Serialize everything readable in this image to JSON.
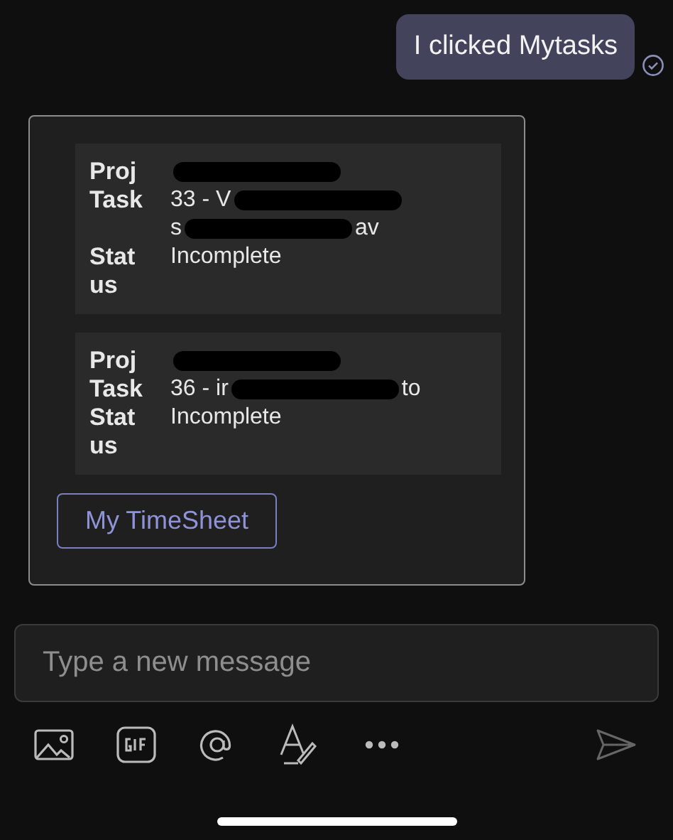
{
  "sent_message": {
    "text": "I clicked Mytasks",
    "delivered": true
  },
  "card": {
    "tasks": [
      {
        "fields": [
          {
            "label": "Proj",
            "lines": [
              [
                {
                  "kind": "redaction"
                }
              ]
            ]
          },
          {
            "label": "Task",
            "lines": [
              [
                {
                  "kind": "text",
                  "text": "33 - V"
                },
                {
                  "kind": "redaction"
                }
              ],
              [
                {
                  "kind": "text",
                  "text": "s"
                },
                {
                  "kind": "redaction"
                },
                {
                  "kind": "text",
                  "text": "av"
                }
              ]
            ]
          },
          {
            "label": "Status",
            "lines": [
              [
                {
                  "kind": "text",
                  "text": "Incomplete"
                }
              ]
            ]
          }
        ]
      },
      {
        "fields": [
          {
            "label": "Proj",
            "lines": [
              [
                {
                  "kind": "redaction"
                }
              ]
            ]
          },
          {
            "label": "Task",
            "lines": [
              [
                {
                  "kind": "text",
                  "text": "36 - ir"
                },
                {
                  "kind": "redaction"
                },
                {
                  "kind": "text",
                  "text": "to"
                }
              ]
            ]
          },
          {
            "label": "Status",
            "lines": [
              [
                {
                  "kind": "text",
                  "text": "Incomplete"
                }
              ]
            ]
          }
        ]
      }
    ],
    "button": "My TimeSheet"
  },
  "composer": {
    "placeholder": "Type a new message"
  }
}
